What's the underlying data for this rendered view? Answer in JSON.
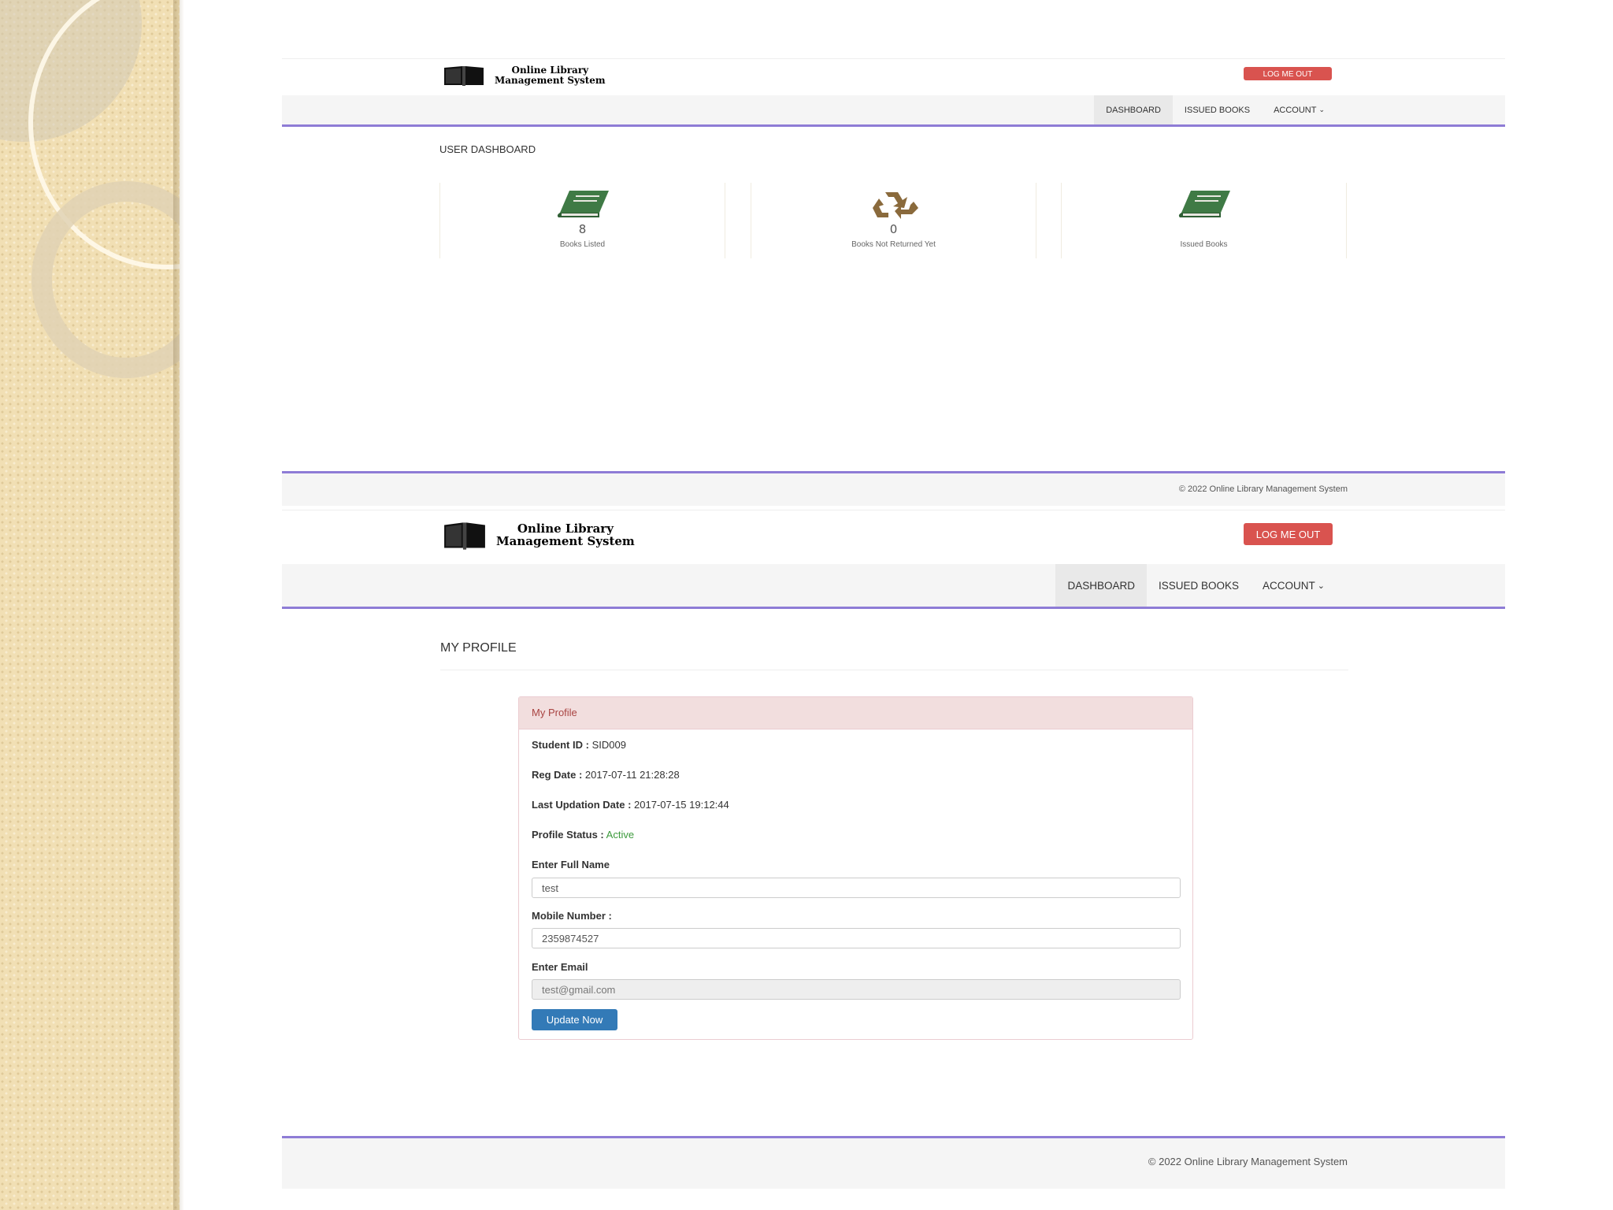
{
  "colors": {
    "accent_line": "#8e7cd6",
    "logout_button": "#d9534f",
    "primary_button": "#337ab7",
    "stat_icon_green": "#3f7a45",
    "stat_icon_brown": "#8a6a3c",
    "profile_status": "#3c9a3c",
    "panel_heading_bg": "#f2dede"
  },
  "dashboard": {
    "header": {
      "app_title_line1": "Online Library",
      "app_title_line2": "Management System",
      "logout_label": "LOG ME OUT"
    },
    "nav": {
      "dashboard": "DASHBOARD",
      "issued_books": "ISSUED BOOKS",
      "account": "ACCOUNT"
    },
    "section_title": "USER DASHBOARD",
    "cards": [
      {
        "icon": "book-icon",
        "count": "8",
        "label": "Books Listed"
      },
      {
        "icon": "recycle-icon",
        "count": "0",
        "label": "Books Not Returned Yet"
      },
      {
        "icon": "book-icon",
        "count": "",
        "label": "Issued Books"
      }
    ],
    "footer": "© 2022 Online Library Management System"
  },
  "profile": {
    "header": {
      "app_title_line1": "Online Library",
      "app_title_line2": "Management System",
      "logout_label": "LOG ME OUT"
    },
    "nav": {
      "dashboard": "DASHBOARD",
      "issued_books": "ISSUED BOOKS",
      "account": "ACCOUNT"
    },
    "section_title": "MY PROFILE",
    "panel_title": "My Profile",
    "student_id_label": "Student ID :",
    "student_id": "SID009",
    "reg_date_label": "Reg Date :",
    "reg_date": "2017-07-11 21:28:28",
    "last_update_label": "Last Updation Date :",
    "last_update": "2017-07-15 19:12:44",
    "status_label": "Profile Status :",
    "status": "Active",
    "full_name_label": "Enter Full Name",
    "full_name_value": "test",
    "mobile_label": "Mobile Number :",
    "mobile_value": "2359874527",
    "email_label": "Enter Email",
    "email_value": "test@gmail.com",
    "update_button": "Update Now",
    "footer": "© 2022 Online Library Management System"
  }
}
